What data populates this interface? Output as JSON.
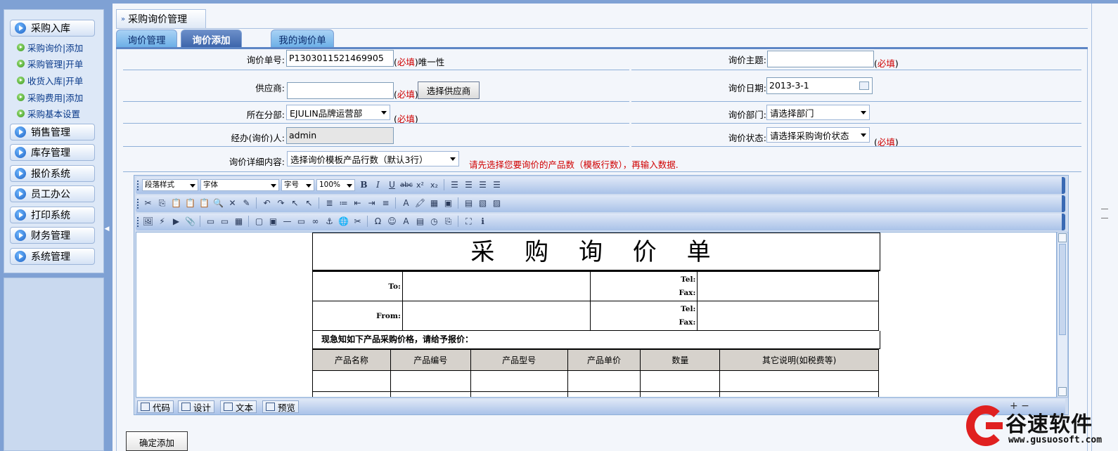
{
  "sidebar": {
    "menus": [
      {
        "label": "采购入库"
      },
      {
        "label": "销售管理"
      },
      {
        "label": "库存管理"
      },
      {
        "label": "报价系统"
      },
      {
        "label": "员工办公"
      },
      {
        "label": "打印系统"
      },
      {
        "label": "财务管理"
      },
      {
        "label": "系统管理"
      }
    ],
    "subitems": [
      {
        "label": "采购询价|添加"
      },
      {
        "label": "采购管理|开单"
      },
      {
        "label": "收货入库|开单"
      },
      {
        "label": "采购费用|添加"
      },
      {
        "label": "采购基本设置"
      }
    ]
  },
  "header": {
    "title": "采购询价管理"
  },
  "tabs": [
    {
      "label": "询价管理",
      "active": false
    },
    {
      "label": "询价添加",
      "active": true
    },
    {
      "label": "我的询价单",
      "active": false
    }
  ],
  "form": {
    "inquiry_no_label": "询价单号:",
    "inquiry_no_value": "P1303011521469905",
    "inquiry_no_hint_open": "(",
    "required": "必填",
    "inquiry_no_hint_close": ")唯一性",
    "subject_label": "询价主题:",
    "subject_value": "",
    "supplier_label": "供应商:",
    "supplier_value": "",
    "choose_supplier": "选择供应商",
    "date_label": "询价日期:",
    "date_value": "2013-3-1",
    "branch_label": "所在分部:",
    "branch_value": "EJULIN品牌运营部",
    "dept_label": "询价部门:",
    "dept_value": "请选择部门",
    "handler_label": "经办(询价)人:",
    "handler_value": "admin",
    "status_label": "询价状态:",
    "status_value": "请选择采购询价状态",
    "detail_label": "询价详细内容:",
    "detail_value": "选择询价模板产品行数（默认3行）",
    "detail_warning": "请先选择您要询价的产品数（模板行数），再输入数据."
  },
  "editor": {
    "paragraph_style": "段落样式",
    "font": "字体",
    "size": "字号",
    "zoom": "100%",
    "modes": [
      {
        "label": "代码"
      },
      {
        "label": "设计"
      },
      {
        "label": "文本"
      },
      {
        "label": "预览"
      }
    ]
  },
  "document": {
    "title": "采 购 询 价 单",
    "to": "To:",
    "from": "From:",
    "tel": "Tel:",
    "fax": "Fax:",
    "notice": "现急知如下产品采购价格，请给予报价：",
    "columns": [
      "产品名称",
      "产品编号",
      "产品型号",
      "产品单价",
      "数量",
      "其它说明(如税费等)"
    ]
  },
  "submit_label": "确定添加",
  "watermark": {
    "name": "谷速软件",
    "url": "www.gusuosoft.com"
  }
}
